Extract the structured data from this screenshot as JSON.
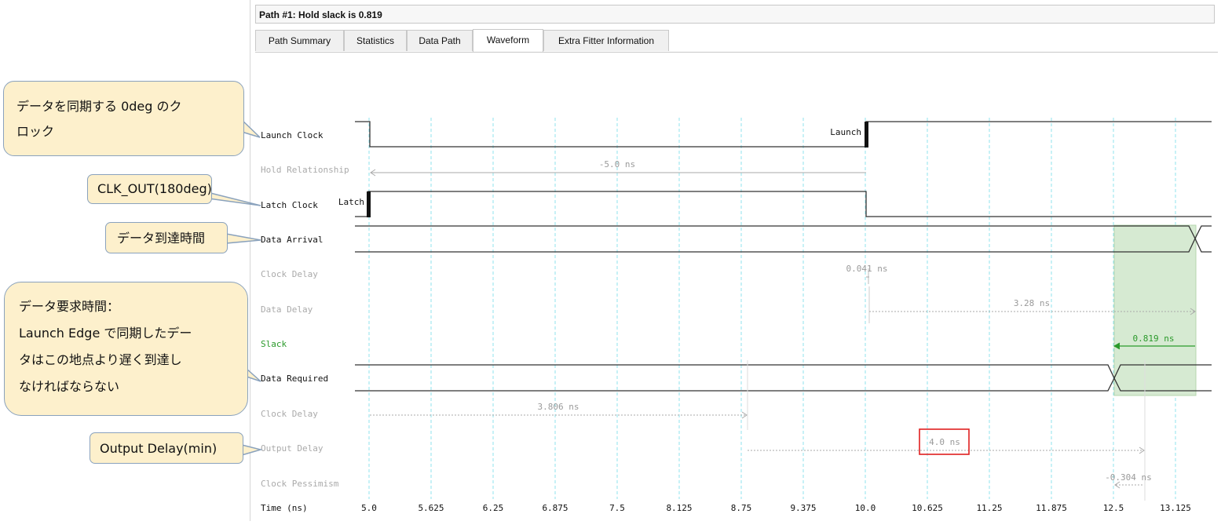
{
  "header": {
    "title": "Path #1: Hold slack is 0.819"
  },
  "tabs": [
    {
      "label": "Path Summary",
      "active": false
    },
    {
      "label": "Statistics",
      "active": false
    },
    {
      "label": "Data Path",
      "active": false
    },
    {
      "label": "Waveform",
      "active": true
    },
    {
      "label": "Extra Fitter Information",
      "active": false
    }
  ],
  "waveform": {
    "rows": {
      "launch_clock": "Launch Clock",
      "hold_relationship": "Hold Relationship",
      "latch_clock": "Latch Clock",
      "data_arrival": "Data Arrival",
      "clock_delay_1": "Clock Delay",
      "data_delay": "Data Delay",
      "slack": "Slack",
      "data_required": "Data Required",
      "clock_delay_2": "Clock Delay",
      "output_delay": "Output Delay",
      "clock_pessimism": "Clock Pessimism",
      "time_axis": "Time (ns)"
    },
    "edge_labels": {
      "launch": "Launch",
      "latch": "Latch"
    },
    "annotations": {
      "hold_relationship": "-5.0 ns",
      "clock_delay_1": "0.041 ns",
      "data_delay": "3.28 ns",
      "slack": "0.819 ns",
      "clock_delay_2": "3.806 ns",
      "output_delay": "4.0 ns",
      "clock_pessimism": "-0.304 ns"
    },
    "time_ticks": [
      "5.0",
      "5.625",
      "6.25",
      "6.875",
      "7.5",
      "8.125",
      "8.75",
      "9.375",
      "10.0",
      "10.625",
      "11.25",
      "11.875",
      "12.5",
      "13.125"
    ],
    "colors": {
      "grid": "#8fe3ec",
      "signal": "#333333",
      "annotation": "#9a9a9a",
      "slack": "#2b9a2b",
      "slack_fill": "#d6ead2",
      "highlight_box": "#e02020"
    }
  },
  "callouts": {
    "launch_clock": "データを同期する 0deg のク\nロック",
    "latch_clock": "CLK_OUT(180deg)",
    "data_arrival": "データ到達時間",
    "data_required": "データ要求時間：\nLaunch Edge で同期したデー\nタはこの地点より遅く到達し\nなければならない",
    "output_delay": "Output Delay(min)"
  }
}
